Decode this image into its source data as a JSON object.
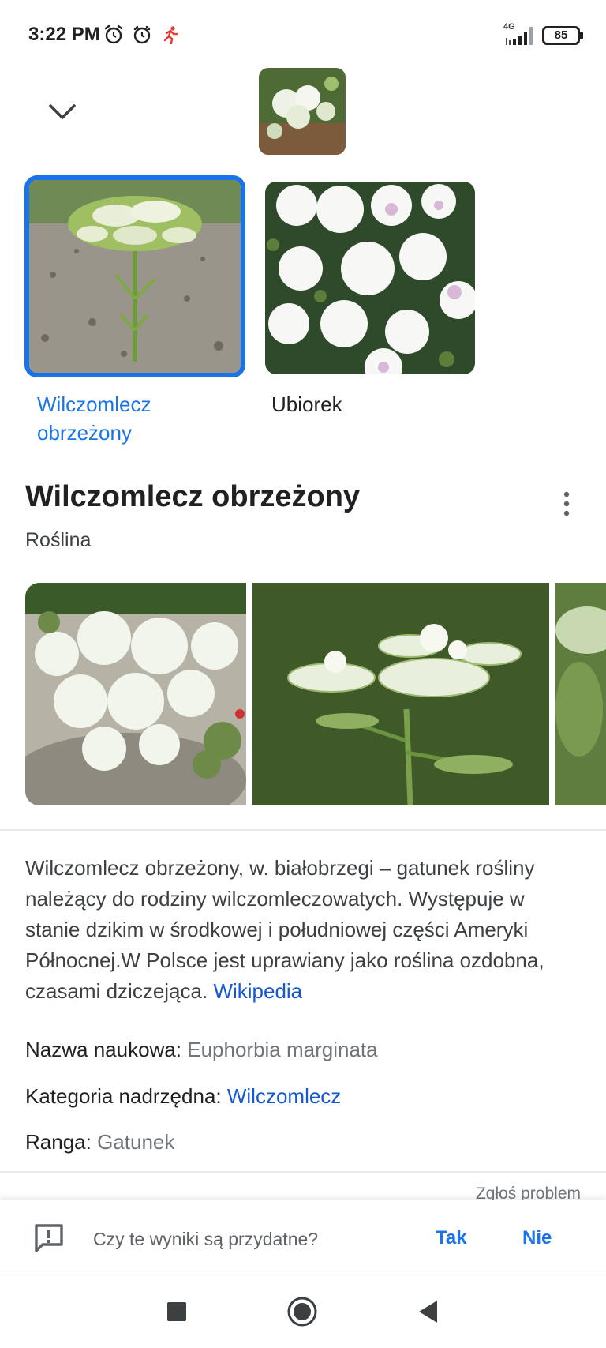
{
  "status_bar": {
    "time": "3:22 PM",
    "network": "4G",
    "battery": "85",
    "icons": [
      "alarm-icon",
      "alarm-clock-icon",
      "running-app-icon",
      "signal-icon",
      "battery-icon"
    ]
  },
  "candidates": [
    {
      "label": "Wilczomlecz obrzeżony",
      "selected": true
    },
    {
      "label": "Ubiorek",
      "selected": false
    }
  ],
  "result": {
    "title": "Wilczomlecz obrzeżony",
    "subtitle": "Roślina",
    "description": "Wilczomlecz obrzeżony, w. białobrzegi – gatunek rośliny należący do rodziny wilczomleczowatych. Występuje w stanie dzikim w środkowej i południowej części Ameryki Północnej.W Polsce jest uprawiany jako roślina ozdobna, czasami dziczejąca.",
    "source_link": "Wikipedia",
    "facts": [
      {
        "label": "Nazwa naukowa:",
        "value": "Euphorbia marginata"
      },
      {
        "label": "Kategoria nadrzędna:",
        "value": "Wilczomlecz"
      },
      {
        "label": "Ranga:",
        "value": "Gatunek"
      }
    ],
    "report_link": "Zgłoś problem"
  },
  "feedback": {
    "question": "Czy te wyniki są przydatne?",
    "yes_label": "Tak",
    "no_label": "Nie"
  },
  "colors": {
    "accent": "#1a73e8",
    "link": "#1558d6",
    "muted": "#70757a"
  }
}
